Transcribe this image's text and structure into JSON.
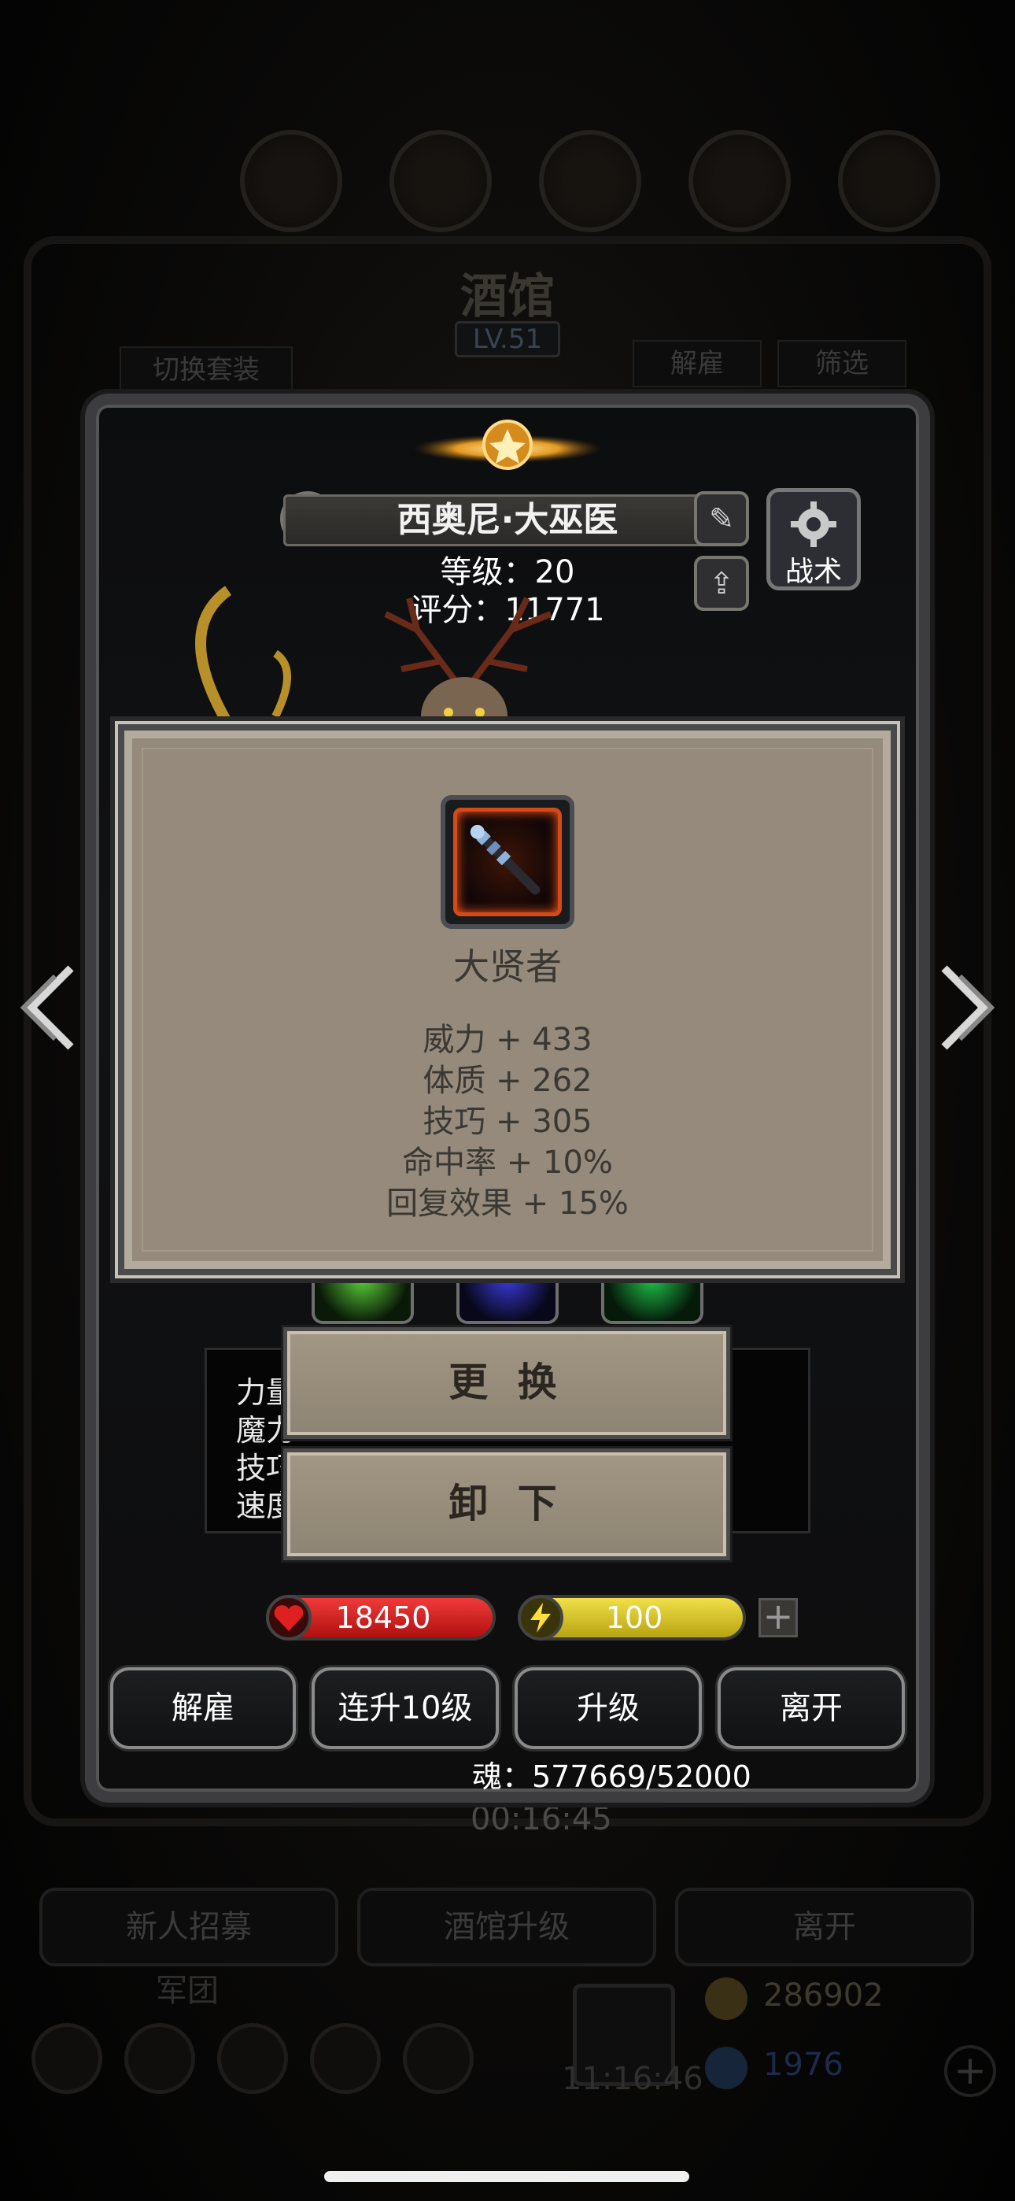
{
  "background": {
    "title": "酒馆",
    "level": "LV.51",
    "switch_set_label": "切换套装",
    "dismiss_label": "解雇",
    "filter_label": "筛选",
    "timer": "00:16:45",
    "recruit_label": "新人招募",
    "tavern_upgrade_label": "酒馆升级",
    "leave_label": "离开",
    "guild_label": "军团",
    "gold": "286902",
    "gems": "1976",
    "clock": "11:16:46"
  },
  "hero": {
    "name": "西奥尼·大巫医",
    "level_line": "等级：20",
    "score_line": "评分：11771",
    "tactic_label": "战术"
  },
  "stats": {
    "labels": [
      "力量",
      "魔力",
      "技巧",
      "速度"
    ]
  },
  "item": {
    "name": "大贤者",
    "attributes": [
      "威力 + 433",
      "体质 + 262",
      "技巧 + 305",
      "命中率 + 10%",
      "回复效果 + 15%"
    ]
  },
  "actions": {
    "replace_label": "更 换",
    "unequip_label": "卸 下"
  },
  "resources": {
    "hp": "18450",
    "energy": "100",
    "plus": "+"
  },
  "buttons": {
    "dismiss": "解雇",
    "upgrade10": "连升10级",
    "upgrade": "升级",
    "leave": "离开"
  },
  "soul_text": "魂：577669/52000",
  "colors": {
    "popup_bg": "#958a7b",
    "hp_bar": "#d91e1e",
    "energy_bar": "#d9c51b",
    "item_frame": "#d54a19"
  }
}
